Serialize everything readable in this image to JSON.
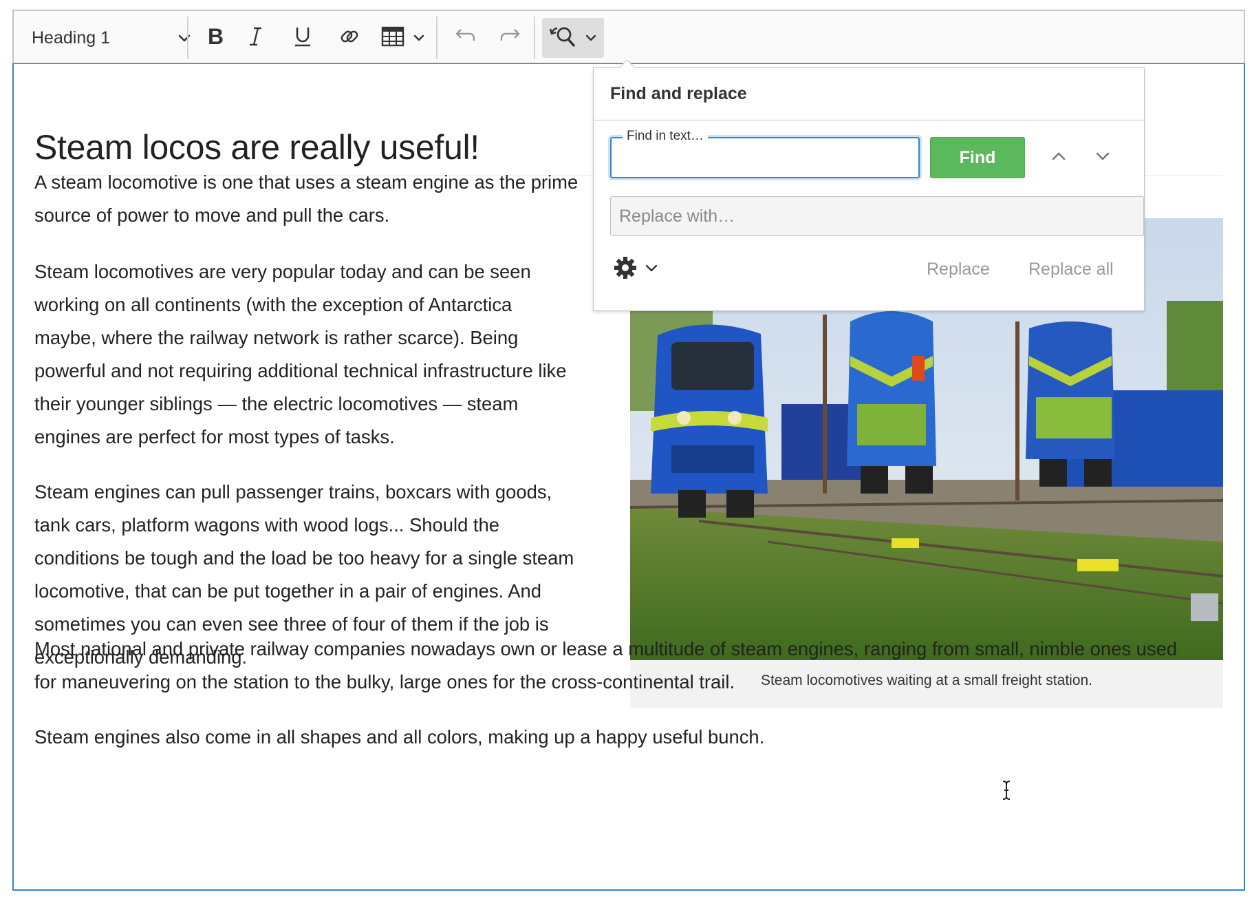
{
  "toolbar": {
    "heading_select": "Heading 1",
    "icons": [
      "bold-icon",
      "italic-icon",
      "underline-icon",
      "link-icon",
      "table-icon",
      "undo-icon",
      "redo-icon",
      "find-replace-icon"
    ]
  },
  "document": {
    "title": "Steam locos are really useful!",
    "paragraphs": [
      [
        "A steam locomotive is one that uses a steam engine as the prime",
        "source of power to move and pull the cars."
      ],
      [
        "Steam locomotives are very popular today and can be seen",
        "working on all continents (with the exception of Antarctica",
        "maybe, where the railway network is rather scarce). Being",
        "powerful and not requiring additional technical infrastructure like",
        "their younger siblings — the electric locomotives — steam",
        "engines are perfect for most types of tasks."
      ],
      [
        "Steam engines can pull passenger trains, boxcars with goods,",
        "tank cars, platform wagons with wood logs... Should the",
        "conditions be tough and the load be too heavy for a single steam",
        "locomotive, that can be put together in a pair of engines. And",
        "sometimes you can even see three of four of them if the job is",
        "exceptionally demanding."
      ],
      [
        "Most national and private railway companies nowadays own or lease a multitude of steam engines, ranging from small, nimble ones used",
        "for maneuvering on the station to the bulky, large ones for the cross-continental trail."
      ],
      [
        "Steam engines also come in all shapes and all colors, making up a happy useful bunch."
      ]
    ],
    "figure_caption": "Steam locomotives waiting at a small freight station."
  },
  "find_replace": {
    "header": "Find and replace",
    "find_label": "Find in text…",
    "find_value": "",
    "find_button": "Find",
    "replace_placeholder": "Replace with…",
    "replace_button": "Replace",
    "replace_all_button": "Replace all",
    "find_button_color": "#5cb85c",
    "focus_color": "#2e86d6"
  }
}
